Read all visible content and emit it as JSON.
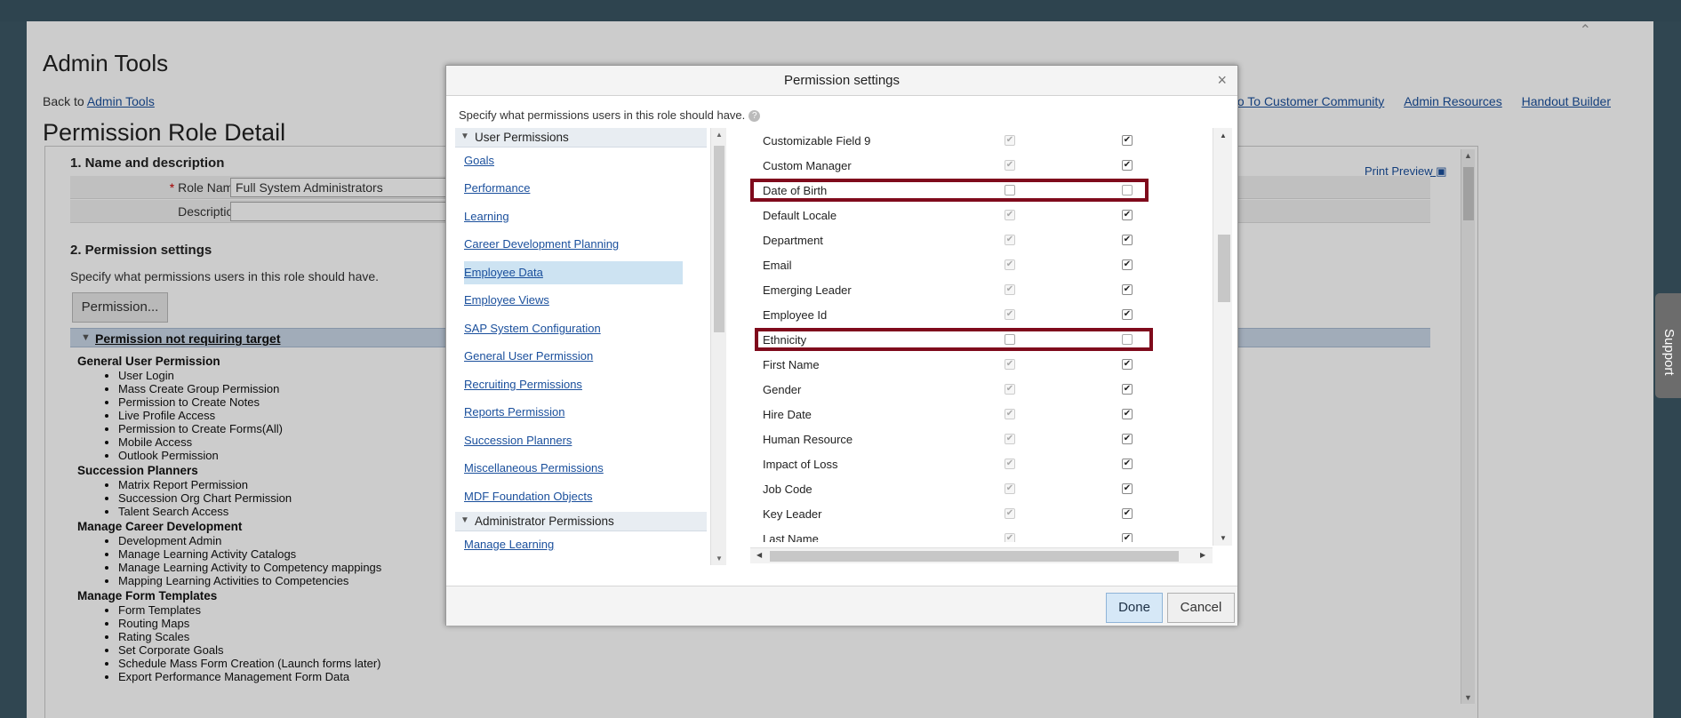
{
  "page": {
    "title": "Admin Tools",
    "back_prefix": "Back to ",
    "back_link": "Admin Tools",
    "top_links": [
      "Go To Customer Community",
      "Admin Resources",
      "Handout Builder"
    ],
    "heading": "Permission Role Detail",
    "print_preview": "Print Preview"
  },
  "name_section": {
    "title": "1. Name and description",
    "role_label": "Role Name:",
    "role_value": "Full System Administrators",
    "desc_label": "Description:",
    "desc_value": ""
  },
  "perm_section": {
    "title": "2. Permission settings",
    "specify": "Specify what permissions users in this role should have.",
    "button": "Permission...",
    "bar_title": "Permission not requiring target",
    "groups": [
      {
        "title": "General User Permission",
        "items": [
          "User Login",
          "Mass Create Group Permission",
          "Permission to Create Notes",
          "Live Profile Access",
          "Permission to Create Forms(All)",
          "Mobile Access",
          "Outlook Permission"
        ]
      },
      {
        "title": "Succession Planners",
        "items": [
          "Matrix Report Permission",
          "Succession Org Chart Permission",
          "Talent Search Access"
        ]
      },
      {
        "title": "Manage Career Development",
        "items": [
          "Development Admin",
          "Manage Learning Activity Catalogs",
          "Manage Learning Activity to Competency mappings",
          "Mapping Learning Activities to Competencies"
        ]
      },
      {
        "title": "Manage Form Templates",
        "items": [
          "Form Templates",
          "Routing Maps",
          "Rating Scales",
          "Set Corporate Goals",
          "Schedule Mass Form Creation (Launch forms later)",
          "Export Performance Management Form Data"
        ]
      }
    ]
  },
  "support": "Support",
  "dialog": {
    "title": "Permission settings",
    "close": "×",
    "specify": "Specify what permissions users in this role should have.",
    "tree": {
      "user_header": "User Permissions",
      "admin_header": "Administrator Permissions",
      "items": [
        "Goals",
        "Performance",
        "Learning",
        "Career Development Planning",
        "Employee Data",
        "Employee Views",
        "SAP System Configuration",
        "General User Permission",
        "Recruiting Permissions",
        "Reports Permission",
        "Succession Planners",
        "Miscellaneous Permissions",
        "MDF Foundation Objects"
      ],
      "selected": "Employee Data",
      "admin_items": [
        "Manage Learning"
      ]
    },
    "fields": [
      {
        "name": "Customizable Field 9",
        "view": true,
        "edit": true
      },
      {
        "name": "Custom Manager",
        "view": true,
        "edit": true
      },
      {
        "name": "Date of Birth",
        "view": false,
        "edit": false,
        "highlight": true
      },
      {
        "name": "Default Locale",
        "view": true,
        "edit": true
      },
      {
        "name": "Department",
        "view": true,
        "edit": true
      },
      {
        "name": "Email",
        "view": true,
        "edit": true
      },
      {
        "name": "Emerging Leader",
        "view": true,
        "edit": true
      },
      {
        "name": "Employee Id",
        "view": true,
        "edit": true
      },
      {
        "name": "Ethnicity",
        "view": false,
        "edit": false,
        "highlight": true
      },
      {
        "name": "First Name",
        "view": true,
        "edit": true
      },
      {
        "name": "Gender",
        "view": true,
        "edit": true
      },
      {
        "name": "Hire Date",
        "view": true,
        "edit": true
      },
      {
        "name": "Human Resource",
        "view": true,
        "edit": true
      },
      {
        "name": "Impact of Loss",
        "view": true,
        "edit": true
      },
      {
        "name": "Job Code",
        "view": true,
        "edit": true
      },
      {
        "name": "Key Leader",
        "view": true,
        "edit": true
      },
      {
        "name": "Last Name",
        "view": true,
        "edit": true
      }
    ],
    "done": "Done",
    "cancel": "Cancel"
  },
  "colors": {
    "highlight": "#7f0a1c",
    "link": "#1a4f9c",
    "selected_row": "#cde3f2"
  }
}
